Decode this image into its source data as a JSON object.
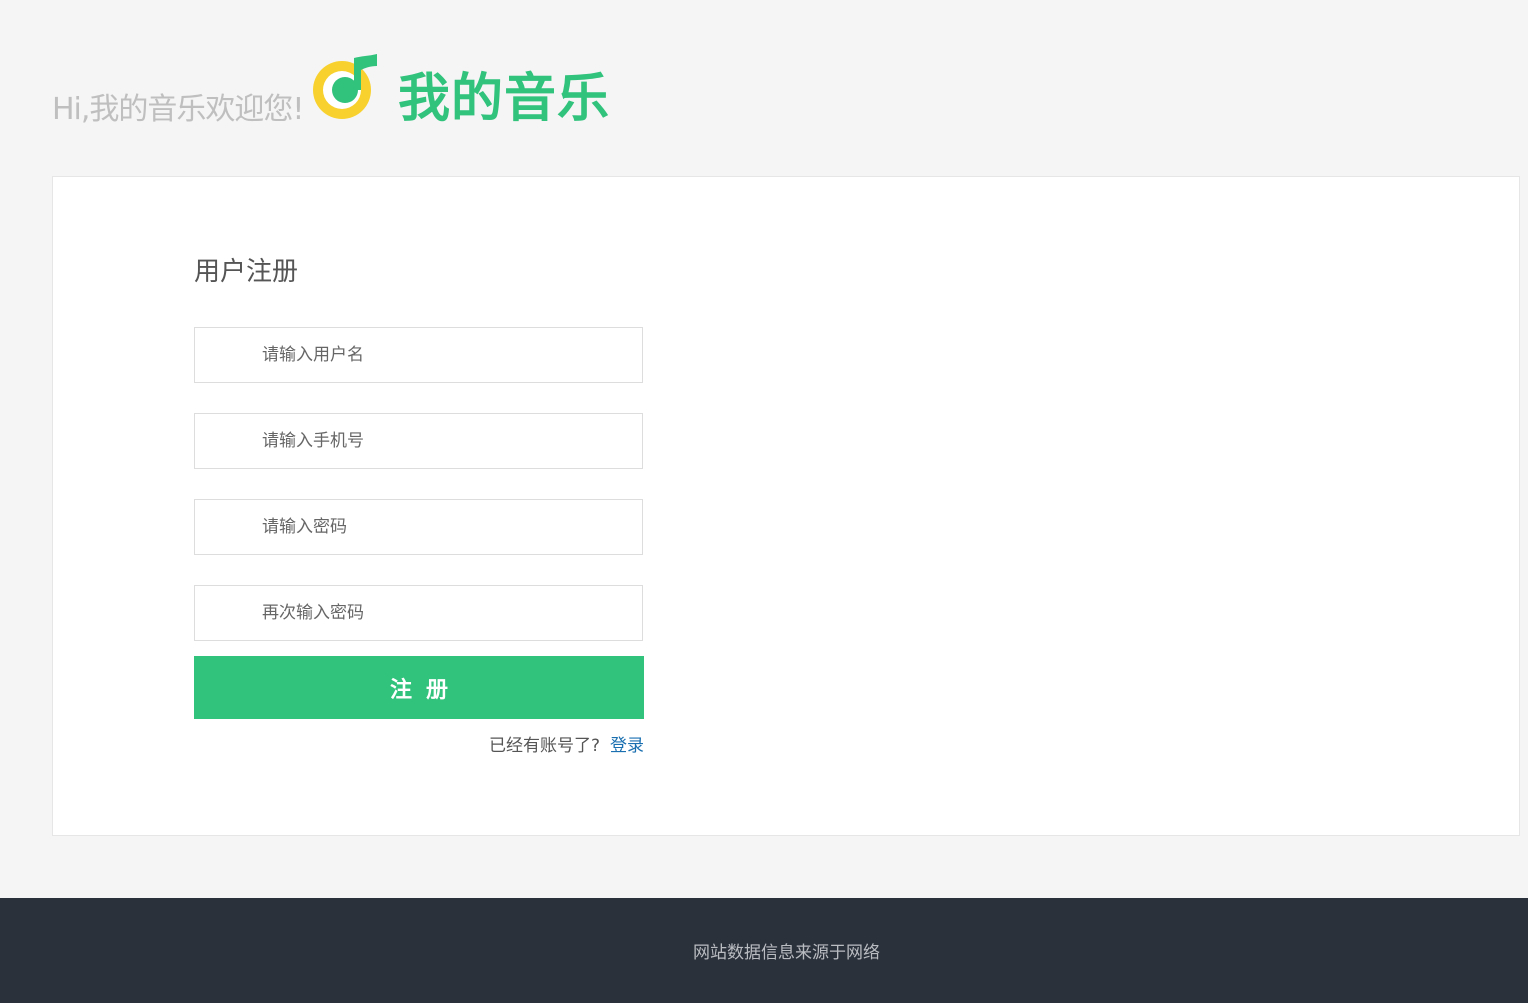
{
  "header": {
    "welcome_text": "Hi,我的音乐欢迎您!",
    "brand_name": "我的音乐",
    "logo_icon": "music-note-icon"
  },
  "form": {
    "title": "用户注册",
    "username_placeholder": "请输入用户名",
    "phone_placeholder": "请输入手机号",
    "password_placeholder": "请输入密码",
    "confirm_password_placeholder": "再次输入密码",
    "submit_label": "注册",
    "login_prompt": "已经有账号了?",
    "login_link": "登录"
  },
  "footer": {
    "text": "网站数据信息来源于网络"
  },
  "colors": {
    "brand_green": "#31c27c",
    "logo_yellow": "#f8d12f",
    "footer_bg": "#2b313b",
    "page_bg": "#f5f5f5",
    "link_blue": "#1a6fb0"
  }
}
